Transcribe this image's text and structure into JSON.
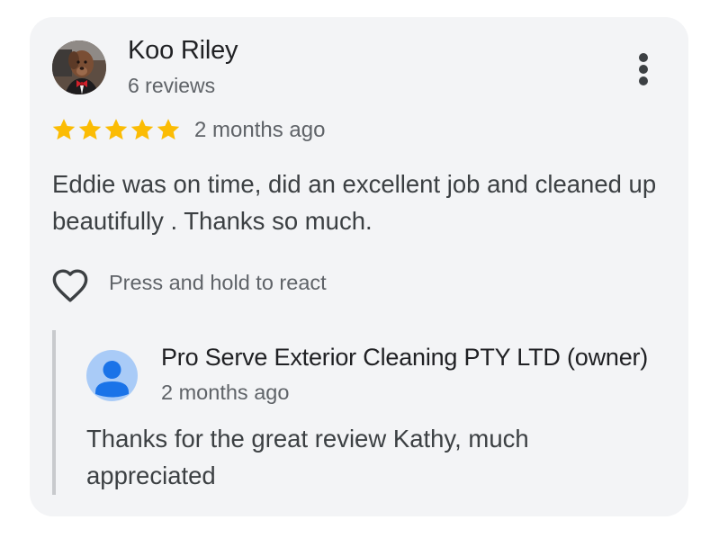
{
  "review": {
    "reviewer_name": "Koo Riley",
    "reviewer_reviews": "6 reviews",
    "rating": 5,
    "rating_max": 5,
    "date": "2 months ago",
    "text": "Eddie was on time, did an excellent job and cleaned up beautifully . Thanks so much.",
    "react_label": "Press and hold to react",
    "star_color": "#fbbc04"
  },
  "owner_reply": {
    "name": "Pro Serve Exterior Cleaning PTY LTD (owner)",
    "date": "2 months ago",
    "text": "Thanks for the great review Kathy, much appreciated",
    "avatar_color": "#a9cbf7",
    "avatar_icon_color": "#1a73e8"
  },
  "icons": {
    "more": "more-vert-icon",
    "star": "star-icon",
    "react": "heart-outline-icon",
    "owner_avatar": "person-icon"
  }
}
